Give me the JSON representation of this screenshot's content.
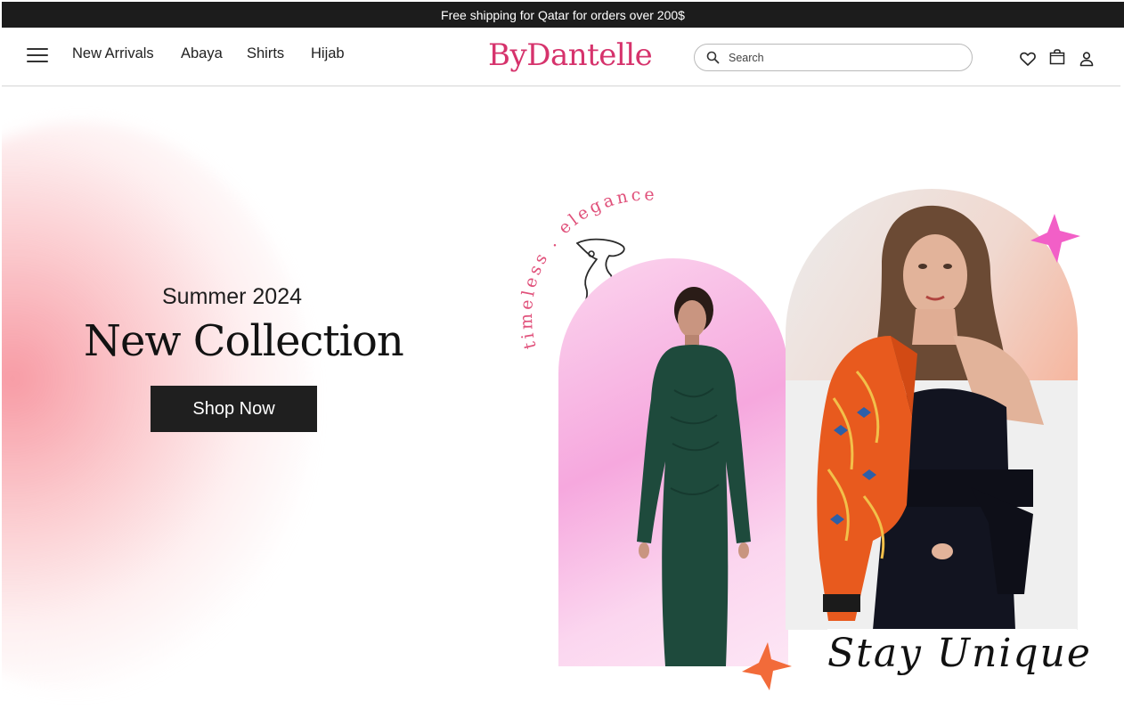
{
  "announcement": {
    "text": "Free shipping for Qatar for orders over 200$"
  },
  "nav": {
    "links": [
      {
        "label": "New Arrivals"
      },
      {
        "label": "Abaya"
      },
      {
        "label": "Shirts"
      },
      {
        "label": "Hijab"
      }
    ],
    "logo": "ByDantelle",
    "search_placeholder": "Search",
    "icons": [
      "menu-icon",
      "search-icon",
      "heart-icon",
      "shopping-bag-icon",
      "user-icon"
    ]
  },
  "hero": {
    "season": "Summer 2024",
    "headline": "New Collection",
    "cta_label": "Shop Now",
    "curved_text": "timeless . elegance .",
    "tagline": "Stay Unique",
    "colors": {
      "logo": "#d6336c",
      "curved_text": "#e0507a",
      "star_pink": "#f25fc7",
      "star_orange": "#f26b3a",
      "button": "#1f1f1f"
    }
  }
}
